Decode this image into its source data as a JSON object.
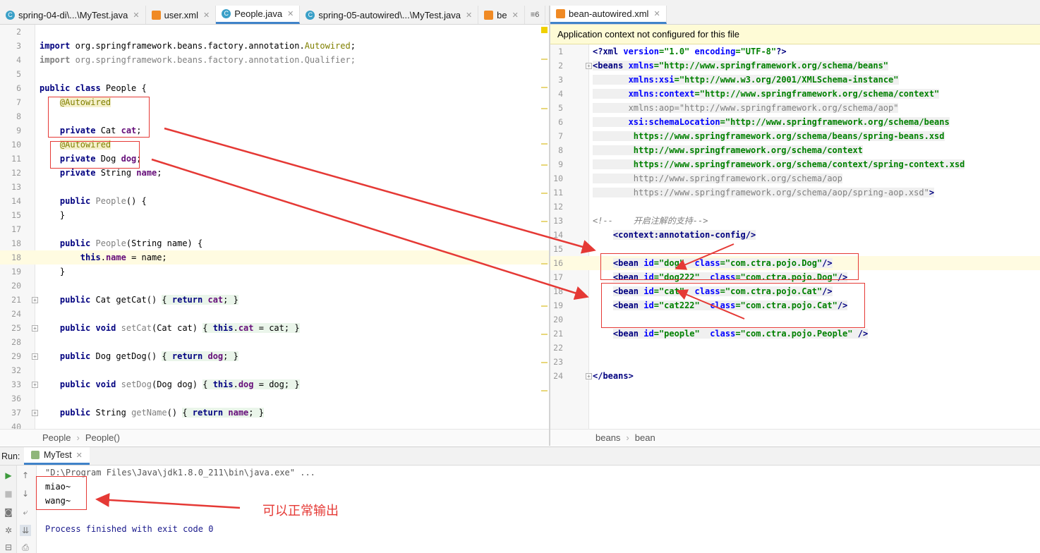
{
  "left_tabs": [
    {
      "label": "spring-04-di\\...\\MyTest.java",
      "icon": "class-icon",
      "active": false
    },
    {
      "label": "user.xml",
      "icon": "xml-icon",
      "active": false
    },
    {
      "label": "People.java",
      "icon": "class-icon",
      "active": true
    },
    {
      "label": "spring-05-autowired\\...\\MyTest.java",
      "icon": "class-icon",
      "active": false
    },
    {
      "label": "be",
      "icon": "xml-icon",
      "active": false
    }
  ],
  "left_tabs_overflow": "≡6",
  "right_tabs": [
    {
      "label": "bean-autowired.xml",
      "icon": "xml-icon",
      "active": true
    }
  ],
  "java_lines": [
    {
      "n": "2",
      "html": ""
    },
    {
      "n": "3",
      "html": "<span class='kw'>import</span> org.springframework.beans.factory.annotation.<span class='ann' style='background:none'>Autowired</span>;"
    },
    {
      "n": "4",
      "html": "<span class='gray'><b>import</b> org.springframework.beans.factory.annotation.Qualifier;</span>"
    },
    {
      "n": "5",
      "html": ""
    },
    {
      "n": "6",
      "html": "<span class='kw'>public class</span> People {"
    },
    {
      "n": "7",
      "html": "    <span class='ann'>@Autowired</span>"
    },
    {
      "n": "8",
      "html": ""
    },
    {
      "n": "9",
      "html": "    <span class='kw'>private</span> Cat <span class='fld'>cat</span>;"
    },
    {
      "n": "10",
      "html": "    <span class='ann'>@Autowired</span>"
    },
    {
      "n": "11",
      "html": "    <span class='kw'>private</span> Dog <span class='fld'>dog</span>;"
    },
    {
      "n": "12",
      "html": "    <span class='kw'>private</span> String <span class='fld'>name</span>;"
    },
    {
      "n": "13",
      "html": ""
    },
    {
      "n": "14",
      "html": "    <span class='kw'>public</span> <span class='gray'>People</span>() {"
    },
    {
      "n": "15",
      "html": "    }"
    },
    {
      "n": "17",
      "html": ""
    },
    {
      "n": "18",
      "html": "    <span class='kw'>public</span> <span class='gray'>People</span>(String name) {"
    },
    {
      "n": "18",
      "html": "        <span class='kw'>this</span>.<span class='fld'>name</span> = name;",
      "hl": true
    },
    {
      "n": "19",
      "html": "    }"
    },
    {
      "n": "20",
      "html": ""
    },
    {
      "n": "21",
      "html": "    <span class='kw'>public</span> Cat getCat() <span class='greenbrace'>{ <span class='kw'>return</span> <span class='fld'>cat</span>; }</span>",
      "fold": true
    },
    {
      "n": "24",
      "html": ""
    },
    {
      "n": "25",
      "html": "    <span class='kw'>public void</span> <span class='gray'>setCat</span>(Cat cat) <span class='greenbrace'>{ <span class='kw'>this</span>.<span class='fld'>cat</span> = cat; }</span>",
      "fold": true
    },
    {
      "n": "28",
      "html": ""
    },
    {
      "n": "29",
      "html": "    <span class='kw'>public</span> Dog getDog() <span class='greenbrace'>{ <span class='kw'>return</span> <span class='fld'>dog</span>; }</span>",
      "fold": true
    },
    {
      "n": "32",
      "html": ""
    },
    {
      "n": "33",
      "html": "    <span class='kw'>public void</span> <span class='gray'>setDog</span>(Dog dog) <span class='greenbrace'>{ <span class='kw'>this</span>.<span class='fld'>dog</span> = dog; }</span>",
      "fold": true
    },
    {
      "n": "36",
      "html": ""
    },
    {
      "n": "37",
      "html": "    <span class='kw'>public</span> String <span class='gray'>getName</span>() <span class='greenbrace'>{ <span class='kw'>return</span> <span class='fld'>name</span>; }</span>",
      "fold": true
    },
    {
      "n": "40",
      "html": ""
    }
  ],
  "xml_banner": "Application context not configured for this file",
  "xml_lines": [
    {
      "n": "1",
      "html": "<span class='tagb'>&lt;?xml </span><span class='attr'>version</span><span class='strA'>=\"1.0\"</span> <span class='attr'>encoding</span><span class='strA'>=\"UTF-8\"</span><span class='tagb'>?&gt;</span>"
    },
    {
      "n": "2",
      "html": "<span class='gbox'><span class='tagb'>&lt;beans </span><span class='attr'>xmlns</span><span class='strA'>=\"http://www.springframework.org/schema/beans\"</span></span>",
      "fold": true
    },
    {
      "n": "3",
      "html": "<span class='gbox'>       <span class='attr'>xmlns:xsi</span><span class='strA'>=\"http://www.w3.org/2001/XMLSchema-instance\"</span></span>"
    },
    {
      "n": "4",
      "html": "<span class='gbox'>       <span class='attr'>xmlns:context</span><span class='strA'>=\"http://www.springframework.org/schema/context\"</span></span>"
    },
    {
      "n": "5",
      "html": "<span class='gbox'>       <span class='gray'>xmlns:aop=\"http://www.springframework.org/schema/aop\"</span></span>"
    },
    {
      "n": "6",
      "html": "<span class='gbox'>       <span class='attr'>xsi:schemaLocation</span><span class='strA'>=\"http://www.springframework.org/schema/beans</span></span>"
    },
    {
      "n": "7",
      "html": "<span class='gbox'>        <span class='strA'>https://www.springframework.org/schema/beans/spring-beans.xsd</span></span>"
    },
    {
      "n": "8",
      "html": "<span class='gbox'>        <span class='strA'>http://www.springframework.org/schema/context</span></span>"
    },
    {
      "n": "9",
      "html": "<span class='gbox'>        <span class='strA'>https://www.springframework.org/schema/context/spring-context.xsd</span></span>"
    },
    {
      "n": "10",
      "html": "<span class='gbox'>        <span class='gray'>http://www.springframework.org/schema/aop</span></span>"
    },
    {
      "n": "11",
      "html": "<span class='gbox'>        <span class='gray'>https://www.springframework.org/schema/aop/spring-aop.xsd\"</span><span class='tagb'>&gt;</span></span>"
    },
    {
      "n": "12",
      "html": ""
    },
    {
      "n": "13",
      "html": "<span class='cmt'>&lt;!--    开启注解的支持--&gt;</span>"
    },
    {
      "n": "14",
      "html": "    <span class='gbox'><span class='tagb'>&lt;context:annotation-config/&gt;</span></span>"
    },
    {
      "n": "15",
      "html": ""
    },
    {
      "n": "16",
      "html": "    <span class='gbox'><span class='tagb'>&lt;bean </span><span class='attr'>id</span><span class='strA'>=\"dog\"</span>  <span class='attr'>class</span><span class='strA'>=\"com.ctra.pojo.Dog\"</span><span class='tagb'>/&gt;</span></span>",
      "hl": true
    },
    {
      "n": "17",
      "html": "    <span class='gbox'><span class='tagb'>&lt;bean </span><span class='attr'>id</span><span class='strA'>=\"dog222\"</span>  <span class='attr'>class</span><span class='strA'>=\"com.ctra.pojo.Dog\"</span><span class='tagb'>/&gt;</span></span>"
    },
    {
      "n": "18",
      "html": "    <span class='gbox'><span class='tagb'>&lt;bean </span><span class='attr'>id</span><span class='strA'>=\"cat\"</span>  <span class='attr'>class</span><span class='strA'>=\"com.ctra.pojo.Cat\"</span><span class='tagb'>/&gt;</span></span>"
    },
    {
      "n": "19",
      "html": "    <span class='gbox'><span class='tagb'>&lt;bean </span><span class='attr'>id</span><span class='strA'>=\"cat222\"</span>  <span class='attr'>class</span><span class='strA'>=\"com.ctra.pojo.Cat\"</span><span class='tagb'>/&gt;</span></span>"
    },
    {
      "n": "20",
      "html": ""
    },
    {
      "n": "21",
      "html": "    <span class='gbox'><span class='tagb'>&lt;bean </span><span class='attr'>id</span><span class='strA'>=\"people\"</span>  <span class='attr'>class</span><span class='strA'>=\"com.ctra.pojo.People\"</span> <span class='tagb'>/&gt;</span></span>"
    },
    {
      "n": "22",
      "html": ""
    },
    {
      "n": "23",
      "html": ""
    },
    {
      "n": "24",
      "html": "<span class='tagb'>&lt;/beans&gt;</span>",
      "fold": true
    }
  ],
  "left_breadcrumb": [
    "People",
    "People()"
  ],
  "right_breadcrumb": [
    "beans",
    "bean"
  ],
  "run": {
    "label": "Run:",
    "tab": "MyTest",
    "output": [
      {
        "text": "\"D:\\Program Files\\Java\\jdk1.8.0_211\\bin\\java.exe\" ...",
        "kind": "cmd"
      },
      {
        "text": "miao~",
        "kind": "out"
      },
      {
        "text": "wang~",
        "kind": "out"
      },
      {
        "text": "",
        "kind": "out"
      },
      {
        "text": "Process finished with exit code 0",
        "kind": "exit"
      }
    ]
  },
  "annotation": "可以正常输出",
  "colors": {
    "annotation_red": "#e53935",
    "active_tab_underline": "#4083c9",
    "keyword": "#000080",
    "string": "#008000"
  }
}
